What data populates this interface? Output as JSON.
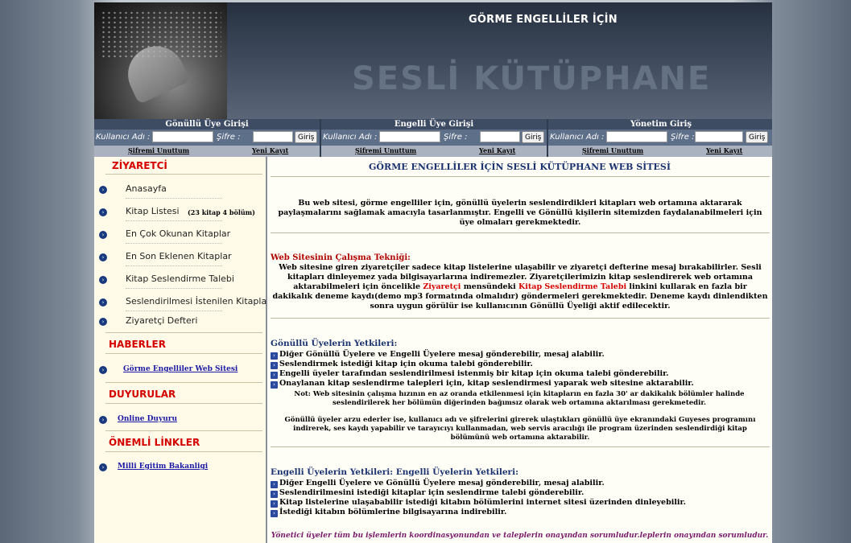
{
  "banner": {
    "title": "GÖRME ENGELLİLER İÇİN",
    "logo_text": "SESLİ KÜTÜPHANE"
  },
  "login_panels": [
    {
      "header": "Gönüllü Üye Girişi",
      "user_label": "Kullanıcı Adı :",
      "pass_label": "Şifre :",
      "button": "Giriş",
      "forgot": "Şifremi Unuttum",
      "register": "Yeni Kayıt"
    },
    {
      "header": "Engelli Üye Girişi",
      "user_label": "Kullanıcı Adı :",
      "pass_label": "Şifre :",
      "button": "Giriş",
      "forgot": "Şifremi Unuttum",
      "register": "Yeni Kayıt"
    },
    {
      "header": "Yönetim Giriş",
      "user_label": "Kullanıcı Adı :",
      "pass_label": "Şifre :",
      "button": "Giriş",
      "forgot": "Şifremi Unuttum",
      "register": "Yeni Kayıt"
    }
  ],
  "sidebar": {
    "visitor_heading": "ZİYARETCİ",
    "nav": [
      {
        "label": "Anasayfa",
        "sub": ""
      },
      {
        "label": "Kitap Listesi",
        "sub": "(23 kitap 4 bölüm)"
      },
      {
        "label": "En Çok Okunan Kitaplar",
        "sub": ""
      },
      {
        "label": "En Son Eklenen Kitaplar",
        "sub": ""
      },
      {
        "label": "Kitap Seslendirme Talebi",
        "sub": ""
      },
      {
        "label": "Seslendirilmesi İstenilen Kitaplar",
        "sub": ""
      },
      {
        "label": "Ziyaretçi Defteri",
        "sub": ""
      }
    ],
    "news_heading": "HABERLER",
    "news_link": "Görme Engelliler Web Sitesi",
    "announce_heading": "DUYURULAR",
    "announce_link": "Online Duyuru",
    "links_heading": "ÖNEMLİ LİNKLER",
    "links_link": "Milli Egitim Bakanligi"
  },
  "content": {
    "title": "GÖRME ENGELLİLER İÇİN SESLİ KÜTÜPHANE WEB SİTESİ",
    "intro": "Bu web sitesi, görme engelliler için, gönüllü üyelerin seslendirdikleri kitapları web ortamına aktararak paylaşmalarını sağlamak amacıyla  tasarlanmıştır. Engelli ve Gönüllü kişilerin sitemizden faydalanabilmeleri için üye olmaları gerekmektedir.",
    "technique_heading": "Web Sitesinin Çalışma Tekniği:",
    "technique_part1": "Web sitesine giren ziyaretçiler sadece kitap listelerine ulaşabilir ve ziyaretçi defterine mesaj bırakabilirler. Sesli kitapları dinleyemez yada bilgisayarlarına indiremezler. Ziyaretçilerimizin kitap seslendirerek web ortamına aktarabilmeleri için öncelikle",
    "technique_red1": "Ziyaretçi",
    "technique_part2": "mensündeki",
    "technique_red2": "Kitap Seslendirme Talebi",
    "technique_part3": "linkini kullarak en fazla bir dakikalık deneme kaydı(demo mp3 formatında olmalıdır) göndermeleri gerekmektedir. Deneme kaydı dinlendikten sonra uygun görülür ise kullanıcının Gönüllü Üyeliği aktif edilecektir.",
    "volunteer_heading": "Gönüllü Üyelerin Yetkileri:",
    "volunteer_items": [
      "Diğer Gönüllü Üyelere ve Engelli Üyelere mesaj gönderebilir, mesaj alabilir.",
      "Seslendirmek istediği kitap için okuma talebi gönderebilir.",
      "Engelli üyeler tarafından seslendirilmesi istenmiş bir kitap için okuma talebi gönderebilir.",
      "Onaylanan kitap seslendirme talepleri için, kitap seslendirmesi yaparak web sitesine aktarabilir."
    ],
    "volunteer_note": "Not: Web sitesinin çalışma hızının en az oranda etkilenmesi için kitapların en fazla 30' ar dakikalık bölümler halinde seslendirilerek her bölümün diğerinden bağımsız olarak web ortamına aktarılması gerekmetedir.",
    "volunteer_extra": "Gönüllü üyeler arzu ederler ise, kullanıcı adı ve şifrelerini girerek ulaştıkları gönüllü üye ekranındaki Guyeses programını indirerek, ses kaydı yapabilir ve tarayıcıyı kullanmadan, web servis aracılığı ile program üzerinden seslendirdiği kitap bölümünü web ortamına aktarabilir.",
    "disabled_heading": "Engelli Üyelerin Yetkileri: Engelli Üyelerin Yetkileri:",
    "disabled_items": [
      "Diğer Engelli Üyelere ve Gönüllü Üyelere mesaj gönderebilir, mesaj alabilir.",
      "Seslendirilmesini istediği kitaplar için seslendirme talebi gönderebilir.",
      "Kitap listelerine ulaşababilir istediği kitabın bölümlerini internet sitesi üzerinden dinleyebilir.",
      "İstediği kitabın bölümlerine bilgisayarına indirebilir."
    ],
    "footer": "Yönetici üyeler tüm bu işlemlerin koordinasyonundan ve taleplerin onayından sorumludur.leplerin onayından sorumludur."
  }
}
